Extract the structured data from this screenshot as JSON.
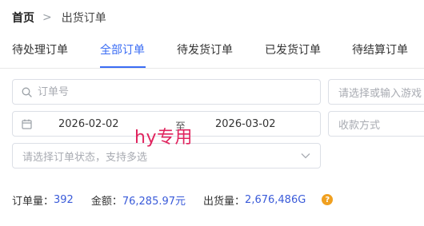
{
  "breadcrumb": {
    "home": "首页",
    "separator": ">",
    "current": "出货订单"
  },
  "tabs": [
    {
      "label": "待处理订单",
      "active": false
    },
    {
      "label": "全部订单",
      "active": true
    },
    {
      "label": "待发货订单",
      "active": false
    },
    {
      "label": "已发货订单",
      "active": false
    },
    {
      "label": "待结算订单",
      "active": false
    }
  ],
  "filters": {
    "order_no_placeholder": "订单号",
    "game_placeholder": "请选择或输入游戏",
    "date_start": "2026-02-02",
    "date_separator": "至",
    "date_end": "2026-03-02",
    "payment_placeholder": "收款方式",
    "status_placeholder": "请选择订单状态，支持多选"
  },
  "watermark": "hy专用",
  "stats": {
    "order_count_label": "订单量：",
    "order_count_value": "392",
    "amount_label": "金额：",
    "amount_value": "76,285.97元",
    "shipped_label": "出货量：",
    "shipped_value": "2,676,486G",
    "help_symbol": "?"
  },
  "colors": {
    "accent": "#3a6cf4",
    "watermark": "#e0245e",
    "help": "#f0a020"
  }
}
